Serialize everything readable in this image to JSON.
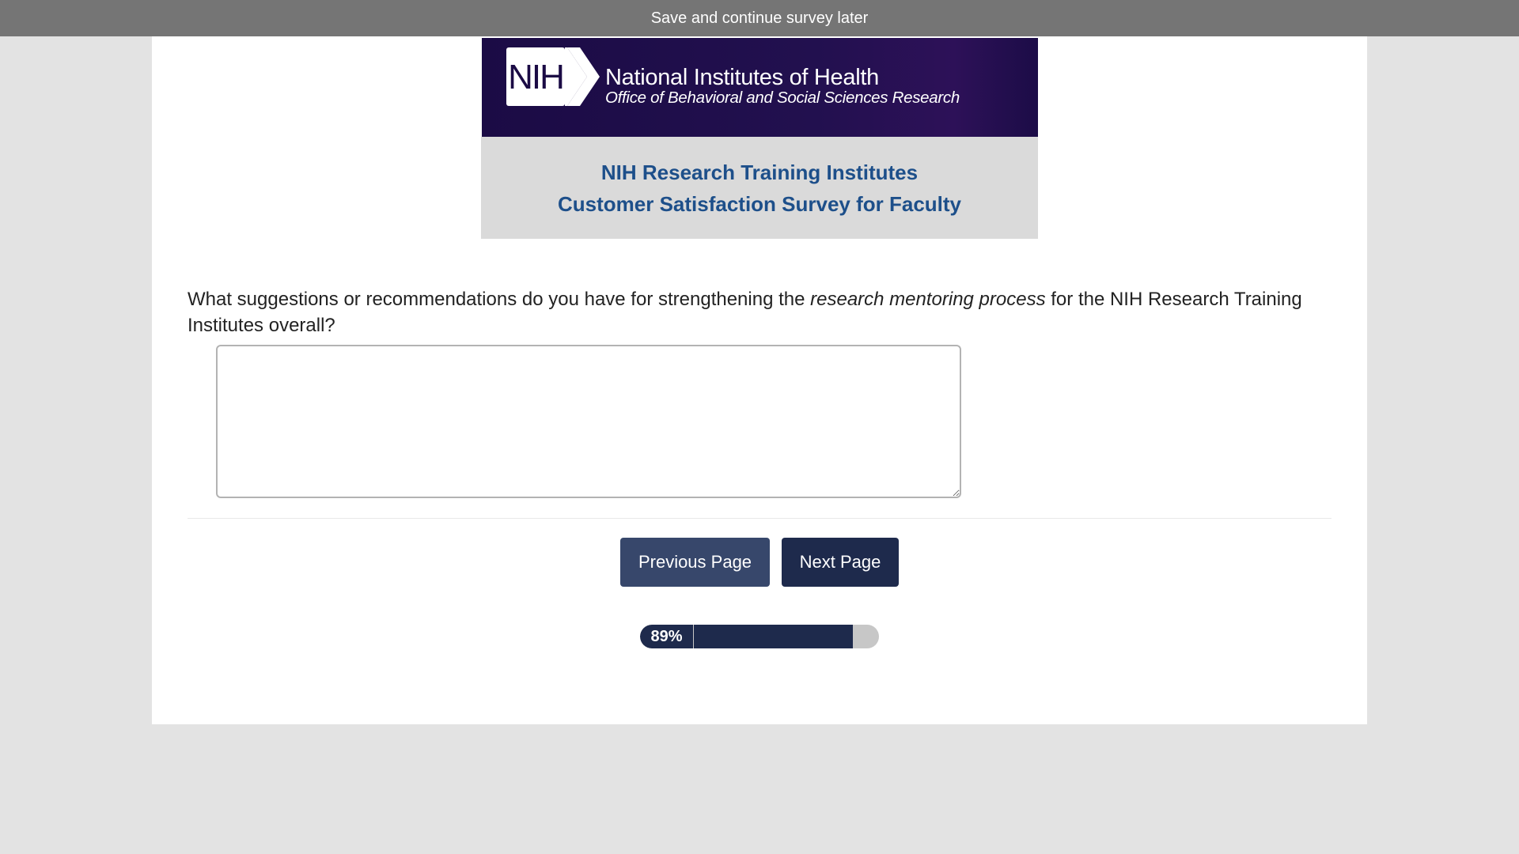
{
  "topbar": {
    "save_later_label": "Save and continue survey later"
  },
  "banner": {
    "logo_text": "NIH",
    "org_name": "National Institutes of Health",
    "org_sub": "Office of Behavioral and Social Sciences Research",
    "title_line1": "NIH Research Training Institutes",
    "title_line2": "Customer Satisfaction Survey for Faculty",
    "colors": {
      "banner_dark": "#1b0b45",
      "title_text": "#1d4f8a",
      "banner_light": "#dadada"
    }
  },
  "question": {
    "text_before": "What suggestions or recommendations do you have for strengthening the ",
    "text_emphasis": "research mentoring process",
    "text_after": " for the NIH Research Training Institutes overall?",
    "answer_value": ""
  },
  "navigation": {
    "previous_label": "Previous Page",
    "next_label": "Next Page",
    "colors": {
      "previous": "#37476b",
      "next": "#1e2a4c"
    }
  },
  "progress": {
    "value_percent": 89,
    "label": "89%"
  }
}
